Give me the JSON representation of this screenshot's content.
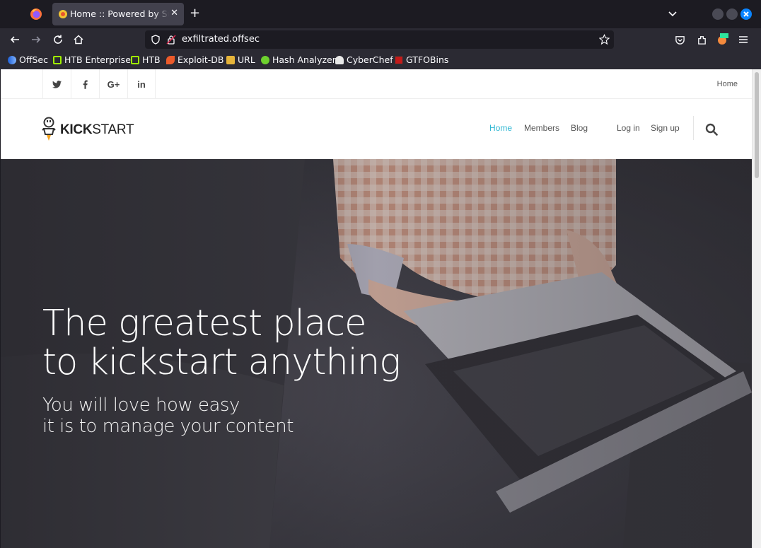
{
  "browser": {
    "tab": {
      "title": "Home :: Powered by Subrion",
      "close": "✕"
    },
    "new_tab": "+",
    "url": "exfiltrated.offsec",
    "bookmarks": [
      "OffSec",
      "HTB Enterprise",
      "HTB",
      "Exploit-DB",
      "URL",
      "Hash Analyzer",
      "CyberChef",
      "GTFOBins"
    ],
    "colors": {
      "tabbar": "#1c1b22",
      "toolbar": "#2b2a33",
      "close_btn": "#0a84ff"
    }
  },
  "site": {
    "social": [
      "twitter",
      "facebook",
      "G+",
      "in"
    ],
    "top_link": "Home",
    "logo": {
      "bold": "KICK",
      "light": "START"
    },
    "menu": {
      "home": "Home",
      "members": "Members",
      "blog": "Blog",
      "login": "Log in",
      "signup": "Sign up"
    },
    "hero": {
      "title_line1": "The greatest place",
      "title_line2": "to kickstart anything",
      "subtitle_line1": "You will love how easy",
      "subtitle_line2": "it is to manage your content"
    },
    "colors": {
      "accent": "#2fb7d3"
    }
  }
}
